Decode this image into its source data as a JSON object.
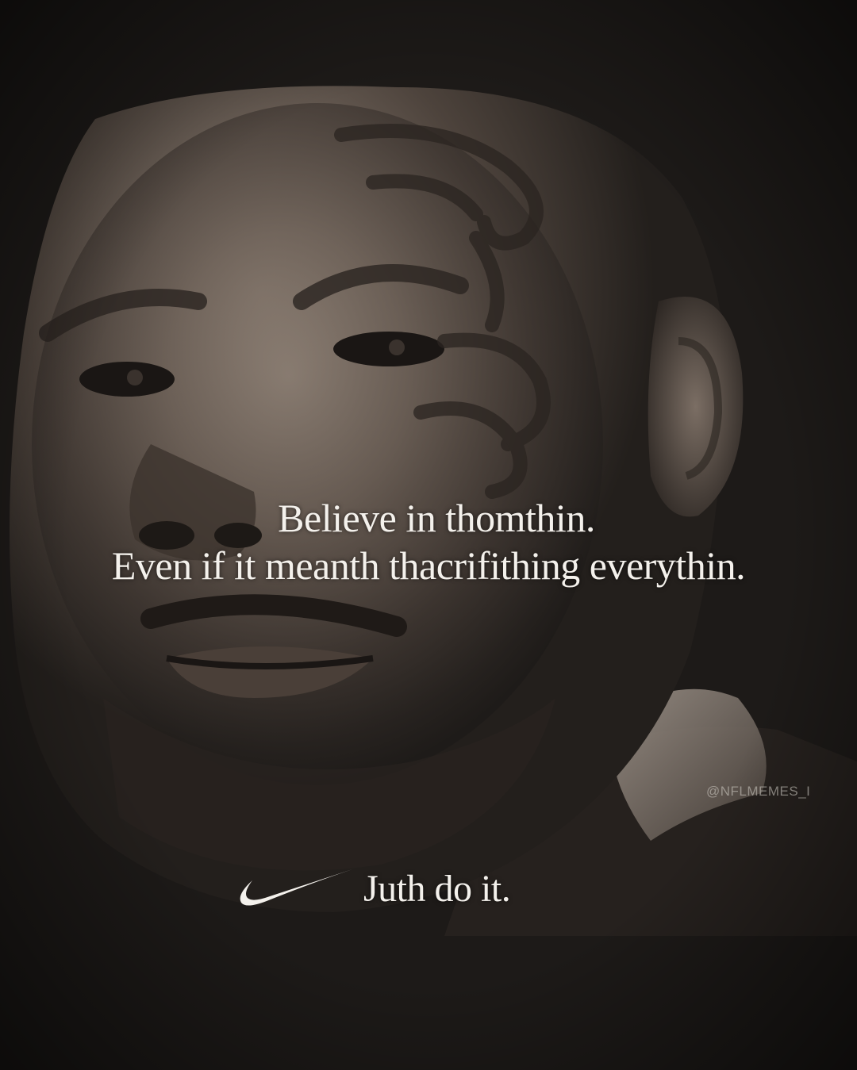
{
  "quote": {
    "line1": "Believe in thomthin.",
    "line2": "Even if it meanth thacrifithing everythin."
  },
  "tagline": "Juth do it.",
  "watermark": "@NFLMEMES_I",
  "logo": {
    "icon": "swoosh-logo-icon",
    "color": "#f4f1ec"
  },
  "colors": {
    "background": "#1d1a18",
    "text": "#f4f1ec"
  }
}
